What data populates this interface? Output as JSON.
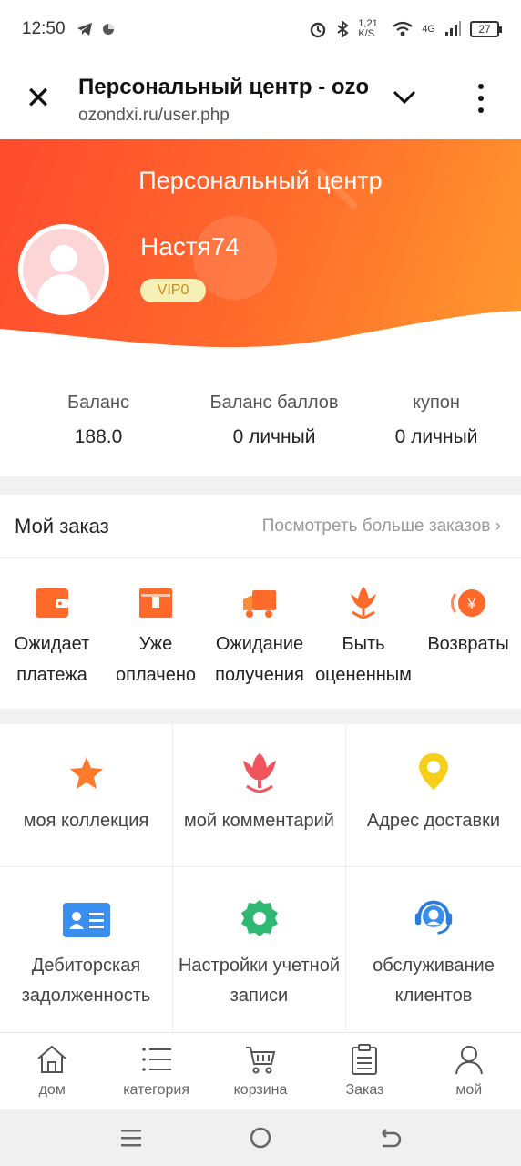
{
  "status_bar": {
    "time": "12:50",
    "net_speed": "1,21 K/S",
    "network": "4G",
    "battery": "27"
  },
  "browser": {
    "title": "Персональный центр - ozo",
    "url": "ozondxi.ru/user.php"
  },
  "header": {
    "title": "Персональный центр",
    "username": "Настя74",
    "vip": "VIP0"
  },
  "stats": [
    {
      "label": "Баланс",
      "value": "188.0"
    },
    {
      "label": "Баланс баллов",
      "value": "0 личный"
    },
    {
      "label": "купон",
      "value": "0 личный"
    }
  ],
  "orders": {
    "title": "Мой заказ",
    "more": "Посмотреть больше заказов",
    "items": [
      {
        "line1": "Ожидает",
        "line2": "платежа",
        "icon": "wallet-icon"
      },
      {
        "line1": "Уже",
        "line2": "оплачено",
        "icon": "box-icon"
      },
      {
        "line1": "Ожидание",
        "line2": "получения",
        "icon": "truck-icon"
      },
      {
        "line1": "Быть",
        "line2": "оцененным",
        "icon": "flower-icon"
      },
      {
        "line1": "Возвраты",
        "line2": "",
        "icon": "refund-icon"
      }
    ]
  },
  "grid": [
    {
      "line1": "моя коллекция",
      "line2": "",
      "icon": "star-icon"
    },
    {
      "line1": "мой комментарий",
      "line2": "",
      "icon": "tulip-icon"
    },
    {
      "line1": "Адрес доставки",
      "line2": "",
      "icon": "location-pin-icon"
    },
    {
      "line1": "Дебиторская",
      "line2": "задолженность",
      "icon": "id-card-icon"
    },
    {
      "line1": "Настройки учетной",
      "line2": "записи",
      "icon": "settings-gear-icon"
    },
    {
      "line1": "обслуживание",
      "line2": "клиентов",
      "icon": "headset-icon"
    }
  ],
  "tabbar": [
    {
      "label": "дом",
      "icon": "home-icon"
    },
    {
      "label": "категория",
      "icon": "list-icon"
    },
    {
      "label": "корзина",
      "icon": "cart-icon"
    },
    {
      "label": "Заказ",
      "icon": "clipboard-icon"
    },
    {
      "label": "мой",
      "icon": "user-icon"
    }
  ],
  "colors": {
    "header_start": "#ff4a2e",
    "header_end": "#ff9a2e",
    "accent": "#ff6a2b",
    "vip_bg": "#f7f0b6"
  }
}
